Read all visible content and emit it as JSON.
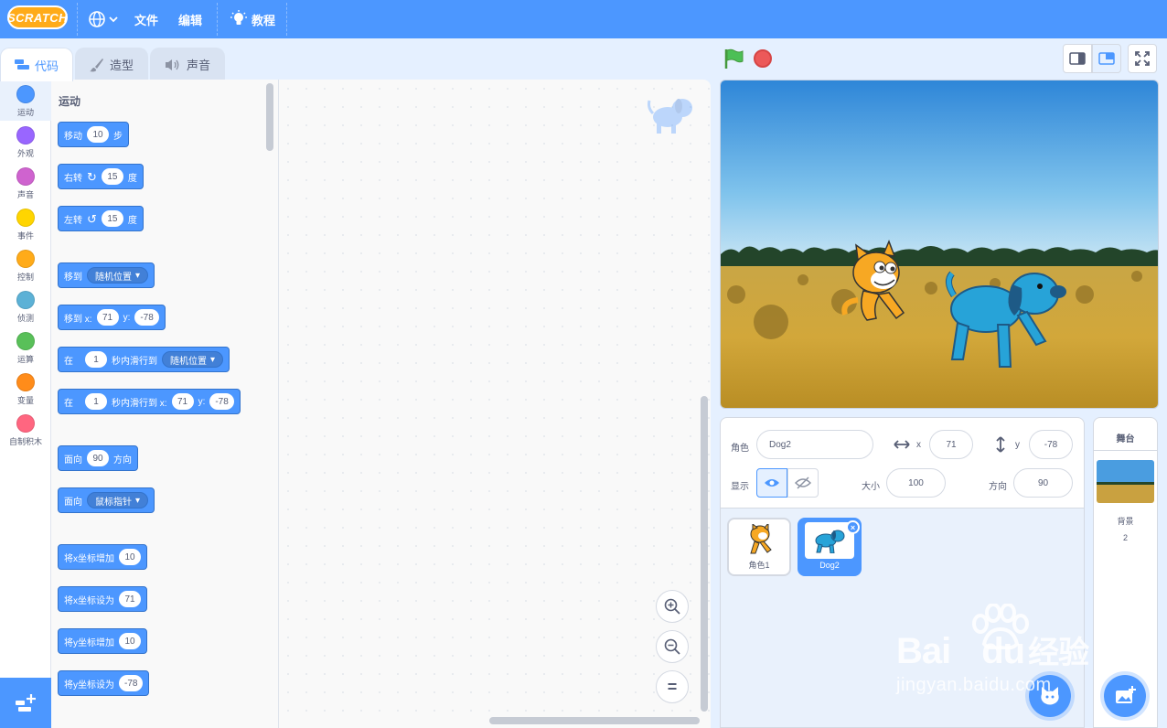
{
  "menubar": {
    "logo": "SCRATCH",
    "file": "文件",
    "edit": "编辑",
    "tutorials": "教程"
  },
  "tabs": {
    "code": "代码",
    "costumes": "造型",
    "sounds": "声音"
  },
  "categories": [
    {
      "label": "运动",
      "color": "#4c97ff"
    },
    {
      "label": "外观",
      "color": "#9966ff"
    },
    {
      "label": "声音",
      "color": "#cf63cf"
    },
    {
      "label": "事件",
      "color": "#ffd500"
    },
    {
      "label": "控制",
      "color": "#ffab19"
    },
    {
      "label": "侦测",
      "color": "#5cb1d6"
    },
    {
      "label": "运算",
      "color": "#59c059"
    },
    {
      "label": "变量",
      "color": "#ff8c1a"
    },
    {
      "label": "自制积木",
      "color": "#ff6680"
    }
  ],
  "palette": {
    "heading": "运动",
    "move": {
      "pre": "移动",
      "val": "10",
      "post": "步"
    },
    "turn_right": {
      "pre": "右转",
      "val": "15",
      "post": "度"
    },
    "turn_left": {
      "pre": "左转",
      "val": "15",
      "post": "度"
    },
    "goto": {
      "pre": "移到",
      "menu": "随机位置"
    },
    "goto_xy": {
      "pre": "移到 x:",
      "x": "71",
      "ylabel": "y:",
      "y": "-78"
    },
    "glide_to": {
      "pre": "在",
      "secs": "1",
      "mid": "秒内滑行到",
      "menu": "随机位置"
    },
    "glide_xy": {
      "pre": "在",
      "secs": "1",
      "mid": "秒内滑行到 x:",
      "x": "71",
      "ylabel": "y:",
      "y": "-78"
    },
    "point_dir": {
      "pre": "面向",
      "val": "90",
      "post": "方向"
    },
    "point_towards": {
      "pre": "面向",
      "menu": "鼠标指针"
    },
    "change_x": {
      "pre": "将x坐标增加",
      "val": "10"
    },
    "set_x": {
      "pre": "将x坐标设为",
      "val": "71"
    },
    "change_y": {
      "pre": "将y坐标增加",
      "val": "10"
    },
    "set_y": {
      "pre": "将y坐标设为",
      "val": "-78"
    }
  },
  "zoom": {
    "reset_label": "="
  },
  "sprite_info": {
    "sprite_label": "角色",
    "sprite_name": "Dog2",
    "x_label": "x",
    "x": "71",
    "y_label": "y",
    "y": "-78",
    "show_label": "显示",
    "size_label": "大小",
    "size": "100",
    "direction_label": "方向",
    "direction": "90"
  },
  "sprites": [
    {
      "name": "角色1",
      "selected": false
    },
    {
      "name": "Dog2",
      "selected": true
    }
  ],
  "stage_pane": {
    "title": "舞台",
    "backdrops_label": "背景",
    "backdrops_count": "2"
  },
  "watermark": {
    "brand": "Bai",
    "brand2": "du",
    "cn": "经验",
    "url": "jingyan.baidu.com"
  }
}
